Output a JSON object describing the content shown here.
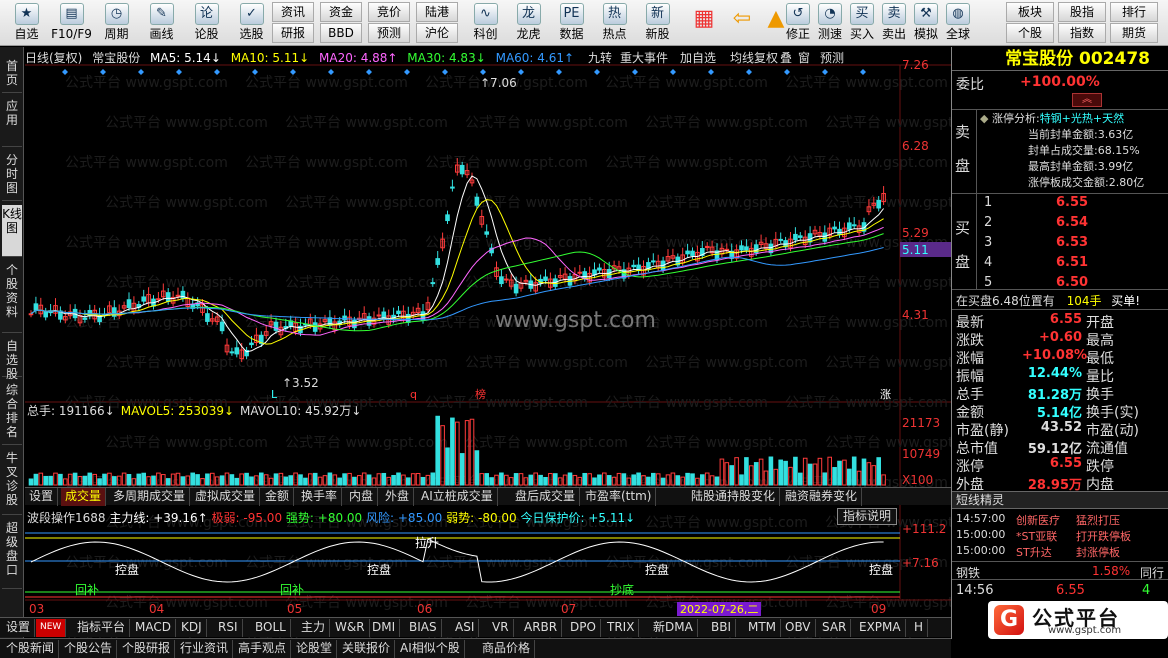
{
  "toolbar": {
    "buttons": [
      {
        "label": "自选",
        "icon": "star-icon"
      },
      {
        "label": "F10/F9",
        "icon": "f10-icon"
      },
      {
        "label": "周期",
        "icon": "clock-icon"
      },
      {
        "label": "画线",
        "icon": "pen-icon"
      },
      {
        "label": "论股",
        "icon": "chat-icon"
      },
      {
        "label": "选股",
        "icon": "select-icon"
      }
    ],
    "grid_buttons": [
      "资讯",
      "资金",
      "竞价",
      "陆港",
      "研报",
      "BBD",
      "预测",
      "沪伦"
    ],
    "buttons2": [
      {
        "label": "科创",
        "icon": "chart-icon"
      },
      {
        "label": "龙虎",
        "icon": "dragon-icon"
      },
      {
        "label": "数据",
        "icon": "pe-icon"
      },
      {
        "label": "热点",
        "icon": "hot-icon"
      },
      {
        "label": "新股",
        "icon": "ipo-icon"
      }
    ],
    "buttons3": [
      {
        "label": "修正",
        "icon": "revise-icon"
      },
      {
        "label": "测速",
        "icon": "speed-icon"
      },
      {
        "label": "买入",
        "icon": "buy-icon"
      },
      {
        "label": "卖出",
        "icon": "sell-icon"
      },
      {
        "label": "模拟",
        "icon": "hammer-icon"
      },
      {
        "label": "全球",
        "icon": "globe-icon"
      }
    ],
    "grid_buttons2": [
      "板块",
      "股指",
      "排行",
      "个股",
      "指数",
      "期货"
    ]
  },
  "sidebar": [
    "首页",
    "应用",
    "分时图",
    "K线图",
    "个股资料",
    "自选股",
    "综合排名",
    "牛叉诊股",
    "超级盘口"
  ],
  "chart": {
    "header": {
      "type": "日线(复权)",
      "name": "常宝股份",
      "ma5": "MA5: 5.14↓",
      "ma10": "MA10: 5.11↓",
      "ma20": "MA20: 4.88↑",
      "ma30": "MA30: 4.83↓",
      "ma60": "MA60: 4.61↑"
    },
    "tools": [
      "九转",
      "重大事件",
      "加自选",
      "均线",
      "复权",
      "叠",
      "窗",
      "预测"
    ],
    "watermark": "www.gspt.com",
    "bg_text": "公式平台 www.gspt.com",
    "price_axis": [
      "7.26",
      "6.28",
      "5.29",
      "4.31"
    ],
    "last_price_tag": "5.11",
    "high_label": "7.06",
    "low_label": "3.52",
    "vol_header": {
      "total": "总手: 191166↓",
      "mavol5": "MAVOL5: 253039↓",
      "mavol10": "MAVOL10: 45.92万↓"
    },
    "vol_axis": [
      "21173",
      "10749",
      "X100"
    ],
    "ind_tabs": [
      "设置",
      "成交量",
      "多周期成交量",
      "虚拟成交量",
      "金额",
      "换手率",
      "内盘",
      "外盘",
      "AI立桩成交量",
      "盘后成交量",
      "市盈率(ttm)",
      "陆股通持股变化",
      "融资融券变化"
    ],
    "ind_header": {
      "name": "波段操作1688",
      "main": "主力线: +39.16↑",
      "weak": "极弱: -95.00",
      "strong": "强势: +80.00",
      "risk": "风险: +85.00",
      "weak2": "弱势: -80.00",
      "protect": "今日保护价: +5.11↓"
    },
    "ind_btn": "指标说明",
    "ind_axis": [
      "+111.2",
      "+7.16"
    ],
    "ind_labels": [
      "控盘",
      "控盘",
      "拉升",
      "控盘",
      "控盘",
      "回补",
      "回补",
      "抄底"
    ],
    "date_axis": [
      "03",
      "04",
      "05",
      "06",
      "07",
      "09"
    ],
    "date_tag": "2022-07-26,二",
    "markers": [
      "L",
      "q",
      "榜",
      "涨"
    ]
  },
  "bottom_tabs": [
    "设置",
    "NEW",
    "指标平台",
    "MACD",
    "KDJ",
    "RSI",
    "BOLL",
    "主力",
    "W&R",
    "DMI",
    "BIAS",
    "ASI",
    "VR",
    "ARBR",
    "DPO",
    "TRIX",
    "新DMA",
    "BBI",
    "MTM",
    "OBV",
    "SAR",
    "EXPMA",
    "H"
  ],
  "bottom_tabs2": [
    "个股新闻",
    "个股公告",
    "个股研报",
    "行业资讯",
    "高手观点",
    "论股堂",
    "关联报价",
    "AI相似个股",
    "商品价格"
  ],
  "right": {
    "title": "常宝股份 002478",
    "webi_label": "委比",
    "webi": "+100.00%",
    "sell_label": "卖盘",
    "zt_title": "涨停分析:",
    "zt_tags": "特钢+光热+天然",
    "zt_lines": [
      "当前封单金额:3.63亿",
      "封单占成交量:68.15%",
      "最高封单金额:3.99亿",
      "涨停板成交金额:2.80亿"
    ],
    "buy_label": "买盘",
    "bids": [
      {
        "n": "1",
        "p": "6.55"
      },
      {
        "n": "2",
        "p": "6.54"
      },
      {
        "n": "3",
        "p": "6.53"
      },
      {
        "n": "4",
        "p": "6.51"
      },
      {
        "n": "5",
        "p": "6.50"
      }
    ],
    "queue": {
      "text": "在买盘6.48位置有",
      "vol": "104手",
      "act": "买单!"
    },
    "stats": [
      [
        "最新",
        "6.55",
        "开盘",
        ""
      ],
      [
        "涨跌",
        "+0.60",
        "最高",
        ""
      ],
      [
        "涨幅",
        "+10.08%",
        "最低",
        ""
      ],
      [
        "振幅",
        "12.44%",
        "量比",
        ""
      ],
      [
        "总手",
        "81.28万",
        "换手",
        ""
      ],
      [
        "金额",
        "5.14亿",
        "换手(实)",
        ""
      ],
      [
        "市盈(静)",
        "43.52",
        "市盈(动)",
        ""
      ],
      [
        "总市值",
        "59.12亿",
        "流通值",
        ""
      ],
      [
        "涨停",
        "6.55",
        "跌停",
        ""
      ],
      [
        "外盘",
        "28.95万",
        "内盘",
        ""
      ]
    ],
    "wizard_title": "短线精灵",
    "wizard": [
      {
        "t": "14:57:00",
        "n": "创新医疗",
        "e": "猛烈打压"
      },
      {
        "t": "15:00:00",
        "n": "*ST亚联",
        "e": "打开跌停板"
      },
      {
        "t": "15:00:00",
        "n": "ST升达",
        "e": "封涨停板"
      }
    ],
    "sector_name": "钢铁",
    "sector_pct": "1.58%",
    "sector_extra": "同行",
    "tick_time": "14:56",
    "tick_price": "6.55",
    "tick_vol": "4"
  },
  "logo": {
    "text": "公式平台",
    "url": "www.gspt.com"
  },
  "colors": {
    "up": "#ff3b3b",
    "down": "#33e0e0",
    "ma5": "#ffffff",
    "ma10": "#ffff00",
    "ma20": "#ff66ff",
    "ma30": "#33ff33",
    "ma60": "#3399ff"
  }
}
